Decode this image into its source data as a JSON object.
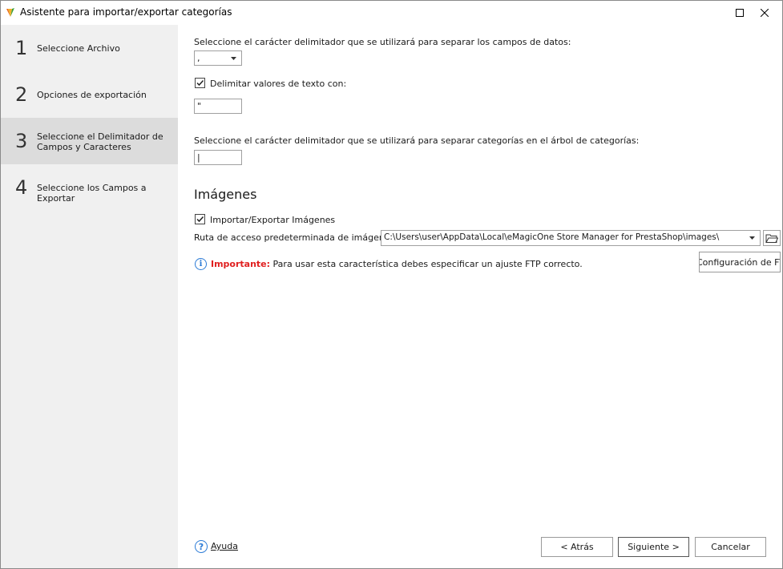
{
  "window": {
    "title": "Asistente para importar/exportar categorías"
  },
  "sidebar": {
    "steps": [
      {
        "num": "1",
        "label": "Seleccione Archivo"
      },
      {
        "num": "2",
        "label": "Opciones de exportación"
      },
      {
        "num": "3",
        "label": "Seleccione el Delimitador de Campos y Caracteres",
        "active": true
      },
      {
        "num": "4",
        "label": "Seleccione los Campos a Exportar"
      }
    ]
  },
  "main": {
    "field_delimiter_label": "Seleccione el carácter delimitador que se utilizará para separar los campos de datos:",
    "field_delimiter_value": ",",
    "text_delimit_checkbox_label": "Delimitar valores de texto con:",
    "text_delimit_checked": true,
    "text_delimit_value": "\"",
    "category_delimiter_label": "Seleccione el carácter delimitador que se utilizará para separar categorías en el árbol de categorías:",
    "category_delimiter_value": "|",
    "images_section_title": "Imágenes",
    "images_checkbox_label": "Importar/Exportar Imágenes",
    "images_checked": true,
    "images_path_label": "Ruta de acceso predeterminada de imágenes",
    "images_path_value": "C:\\Users\\user\\AppData\\Local\\eMagicOne Store Manager for PrestaShop\\images\\",
    "important_label": "Importante:",
    "important_text": "Para usar esta característica debes especificar un ajuste FTP correcto.",
    "ftp_button_label": "Configuración de FTP"
  },
  "footer": {
    "help_label": "Ayuda",
    "back_label": "< Atrás",
    "next_label": "Siguiente >",
    "cancel_label": "Cancelar"
  }
}
